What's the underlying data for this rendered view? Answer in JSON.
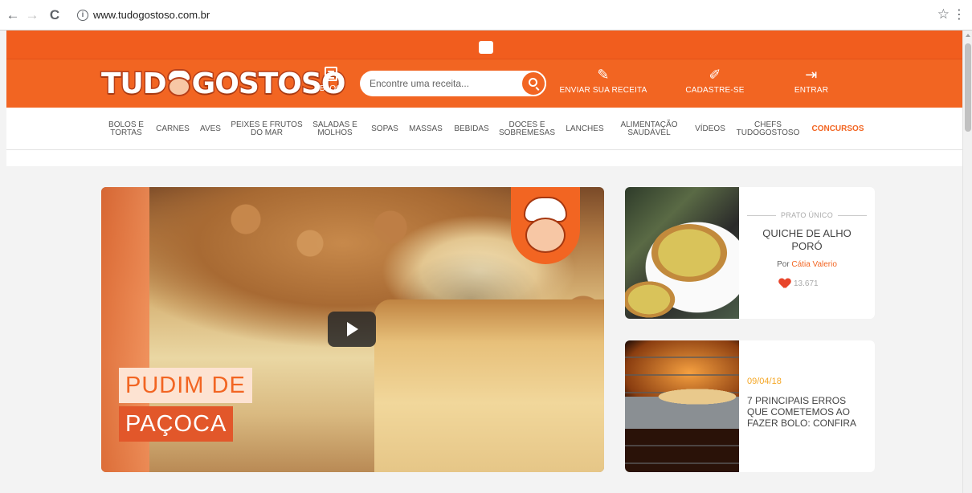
{
  "browser": {
    "url": "www.tudogostoso.com.br",
    "back_glyph": "←",
    "forward_glyph": "→",
    "reload_glyph": "C",
    "info_glyph": "i",
    "star_glyph": "☆",
    "menu_glyph": "⋮"
  },
  "header": {
    "logo_left": "TUD",
    "logo_right": "GOSTOSO",
    "blog_label": "BLOG",
    "search_placeholder": "Encontre uma receita...",
    "send_recipe_label": "ENVIAR SUA RECEITA",
    "signup_label": "CADASTRE-SE",
    "login_label": "ENTRAR",
    "send_icon": "✎",
    "signup_icon": "✐",
    "login_icon": "⇥"
  },
  "categories": [
    {
      "line1": "BOLOS E",
      "line2": "TORTAS"
    },
    {
      "line1": "CARNES",
      "line2": ""
    },
    {
      "line1": "AVES",
      "line2": ""
    },
    {
      "line1": "PEIXES E FRUTOS",
      "line2": "DO MAR"
    },
    {
      "line1": "SALADAS E",
      "line2": "MOLHOS"
    },
    {
      "line1": "SOPAS",
      "line2": ""
    },
    {
      "line1": "MASSAS",
      "line2": ""
    },
    {
      "line1": "BEBIDAS",
      "line2": ""
    },
    {
      "line1": "DOCES E",
      "line2": "SOBREMESAS"
    },
    {
      "line1": "LANCHES",
      "line2": ""
    },
    {
      "line1": "ALIMENTAÇÃO",
      "line2": "SAUDÁVEL"
    },
    {
      "line1": "VÍDEOS",
      "line2": ""
    },
    {
      "line1": "CHEFS",
      "line2": "TUDOGOSTOSO"
    },
    {
      "line1": "CONCURSOS",
      "line2": ""
    }
  ],
  "hero": {
    "title_line1": "PUDIM DE",
    "title_line2": "PAÇOCA"
  },
  "card1": {
    "category": "PRATO ÚNICO",
    "title": "QUICHE DE ALHO PORÓ",
    "by": "Por",
    "author": "Cátia Valerio",
    "likes": "13.671"
  },
  "card2": {
    "date": "09/04/18",
    "title": "7 PRINCIPAIS ERROS QUE COMETEMOS AO FAZER BOLO: CONFIRA"
  },
  "colors": {
    "brand_orange": "#f26522",
    "date_yellow": "#f5a623",
    "heart_red": "#e8452b"
  }
}
